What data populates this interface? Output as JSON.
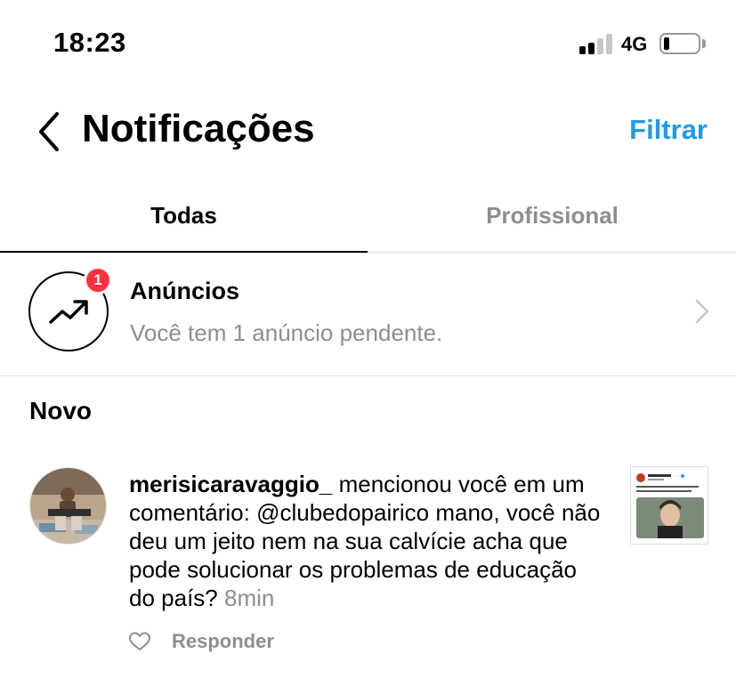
{
  "status_bar": {
    "time": "18:23",
    "network": "4G",
    "signal_bars": 2,
    "battery_level": 0.15
  },
  "header": {
    "title": "Notificações",
    "filter_label": "Filtrar",
    "back_icon": "chevron-left-icon"
  },
  "tabs": [
    {
      "label": "Todas",
      "active": true
    },
    {
      "label": "Profissional",
      "active": false
    }
  ],
  "ads": {
    "title": "Anúncios",
    "subtitle": "Você tem 1 anúncio pendente.",
    "badge_count": "1",
    "icon": "trending-up-icon"
  },
  "section": {
    "title": "Novo"
  },
  "notification": {
    "username": "merisicaravaggio_",
    "message": " mencionou você em um comentário: @clubedopairico mano, você não deu um jeito nem na sua calvície acha que pode solucionar os problemas de educação do país?",
    "time": "8min",
    "reply_label": "Responder"
  },
  "colors": {
    "accent": "#1d9bf0",
    "badge": "#ff3040",
    "muted": "#8e8e8e",
    "divider": "#dbdbdb"
  }
}
